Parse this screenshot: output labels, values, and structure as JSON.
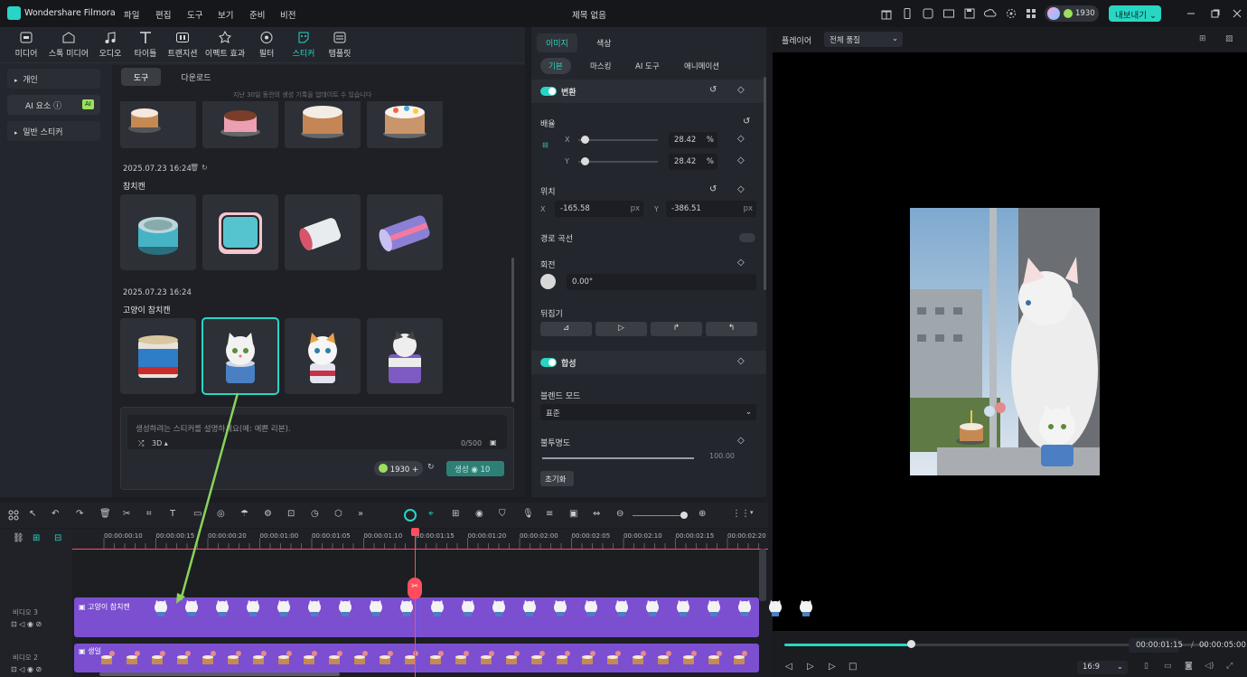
{
  "app": {
    "name": "Wondershare Filmora",
    "doc_title": "제목 없음",
    "menu": [
      "파일",
      "편집",
      "도구",
      "보기",
      "준비",
      "비전"
    ],
    "credits": "1930",
    "export_label": "내보내기"
  },
  "media_tabs": [
    {
      "label": "미디어",
      "icon": "media-icon"
    },
    {
      "label": "스톡 미디어",
      "icon": "stock-media-icon"
    },
    {
      "label": "오디오",
      "icon": "audio-icon"
    },
    {
      "label": "타이틀",
      "icon": "title-icon"
    },
    {
      "label": "트랜지션",
      "icon": "transition-icon"
    },
    {
      "label": "이펙트 효과",
      "icon": "effects-icon"
    },
    {
      "label": "필터",
      "icon": "filter-icon"
    },
    {
      "label": "스티커",
      "icon": "sticker-icon",
      "active": true
    },
    {
      "label": "템플릿",
      "icon": "template-icon"
    }
  ],
  "sidebar": {
    "items": [
      "개인",
      "AI 요소",
      "일반 스티커"
    ],
    "ai_badge": "AI"
  },
  "sticker_panel": {
    "sub_tabs": [
      "도구",
      "다운로드"
    ],
    "notice": "지난 30일 동안의 생성 기록을 업데이트 수 있습니다",
    "groups": [
      {
        "date": "",
        "title": "",
        "items": [
          "cake-sticker-1",
          "cake-sticker-2",
          "cake-sticker-3",
          "cake-sticker-4"
        ]
      },
      {
        "date": "2025.07.23 16:24",
        "title": "참치캔",
        "items": [
          "tuna-can-1",
          "tuna-can-2",
          "tuna-can-3",
          "tuna-can-4"
        ]
      },
      {
        "date": "2025.07.23 16:24",
        "title": "고양이 참치캔",
        "items": [
          "cat-tuna-1",
          "cat-tuna-2",
          "cat-tuna-3",
          "cat-tuna-4"
        ]
      }
    ],
    "prompt_placeholder": "생성하려는 스티커를 설명하세요(예: 예쁜 리본).",
    "style_value": "3D",
    "char_count": "0/500",
    "credit_value": "1930",
    "generate_label": "생성",
    "generate_cost": "10"
  },
  "properties": {
    "tabs": [
      "이미지",
      "색상"
    ],
    "sub_tabs": [
      "기본",
      "마스킹",
      "AI 도구",
      "애니메이션"
    ],
    "transform_title": "변환",
    "scale_label": "배율",
    "scale_x": "28.42",
    "scale_y": "28.42",
    "percent": "%",
    "position_label": "위치",
    "pos_x": "-165.58",
    "pos_y": "-386.51",
    "px_unit": "px",
    "path_curve_label": "경로 곡선",
    "rotation_label": "회전",
    "rotation_value": "0.00°",
    "flip_label": "뒤집기",
    "compositing_title": "합성",
    "blend_mode_label": "블렌드 모드",
    "blend_mode_value": "표준",
    "opacity_label": "불투명도",
    "opacity_value": "100.00",
    "reset_label": "초기화",
    "x_label": "X",
    "y_label": "Y"
  },
  "preview": {
    "player_label": "플레이어",
    "quality_value": "전체 품질",
    "current_time": "00:00:01:15",
    "total_time": "00:00:05:00",
    "aspect": "16:9",
    "progress": 0.3
  },
  "timeline": {
    "ticks": [
      "00:00:00:10",
      "00:00:00:15",
      "00:00:00:20",
      "00:00:01:00",
      "00:00:01:05",
      "00:00:01:10",
      "00:00:01:15",
      "00:00:01:20",
      "00:00:02:00",
      "00:00:02:05",
      "00:00:02:10",
      "00:00:02:15",
      "00:00:02:20"
    ],
    "track1_name": "비디오 3",
    "track2_name": "비디오 2",
    "clip1_label": "고양이 참치캔",
    "clip2_label": "생일"
  },
  "colors": {
    "accent": "#28d6c4",
    "clip": "#7b4fd0",
    "playhead": "#ff4d5e",
    "arrow": "#8bd35a"
  }
}
